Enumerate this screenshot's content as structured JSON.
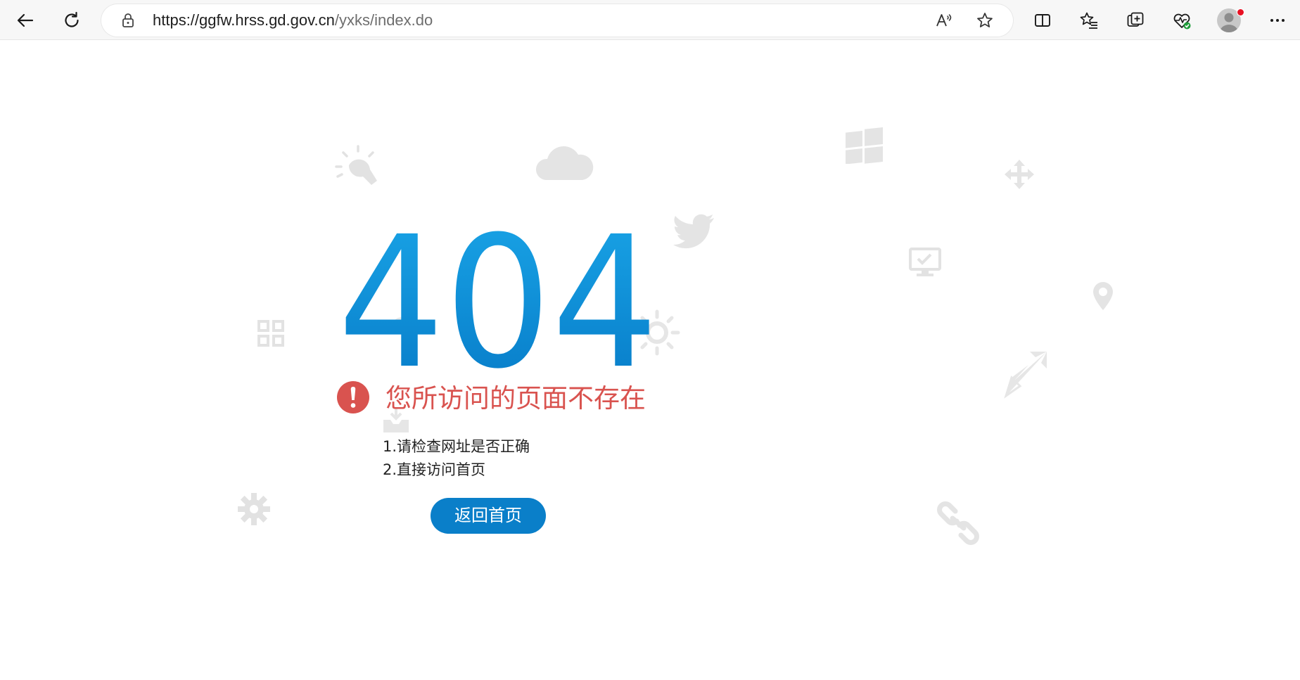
{
  "browser": {
    "url_domain": "https://ggfw.hrss.gd.gov.cn",
    "url_path": "/yxks/index.do",
    "icons": {
      "back": "back-arrow-icon",
      "refresh": "refresh-icon",
      "lock": "lock-icon",
      "read_aloud": "read-aloud-icon",
      "favorite": "star-icon",
      "split_screen": "split-screen-icon",
      "favorites": "favorites-list-icon",
      "collections": "collections-icon",
      "performance": "browser-essentials-icon",
      "profile": "profile-avatar",
      "more": "more-dots-icon"
    }
  },
  "page": {
    "error_code": "404",
    "error_message": "您所访问的页面不存在",
    "hints": [
      "1.请检查网址是否正确",
      "2.直接访问首页"
    ],
    "home_button_label": "返回首页"
  },
  "colors": {
    "code_gradient_top": "#1aa6e8",
    "code_gradient_bottom": "#0679c6",
    "error_red": "#d9534f",
    "button_blue": "#0a7fc9",
    "decor_gray": "#e4e4e4"
  }
}
